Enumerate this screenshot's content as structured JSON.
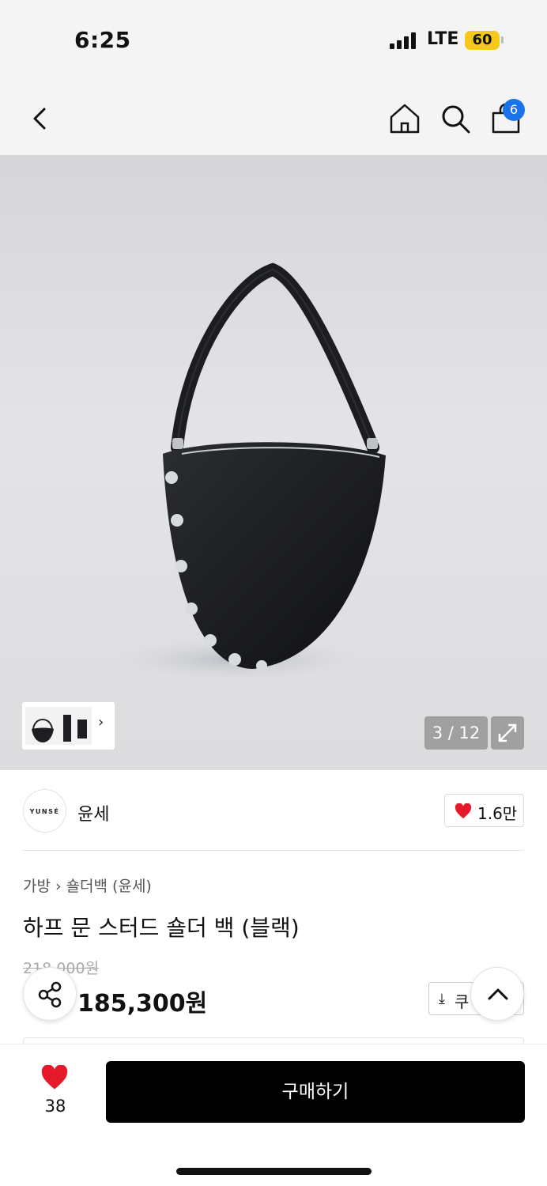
{
  "status": {
    "time": "6:25",
    "network": "LTE",
    "battery": "60"
  },
  "nav": {
    "back_icon": "chevron-left-icon",
    "home_icon": "home-icon",
    "search_icon": "search-icon",
    "cart_icon": "shopping-bag-icon",
    "cart_count": "6",
    "badge_color": "#1a73e8"
  },
  "gallery": {
    "counter": "3 / 12",
    "expand_icon": "expand-icon",
    "thumb_chevron": "›"
  },
  "brand": {
    "logo_text": "YUNSÉ",
    "name": "윤세",
    "likes": "1.6만"
  },
  "breadcrumb": {
    "category": "가방",
    "separator": "›",
    "subcategory": "숄더백 (윤세)"
  },
  "product": {
    "name": "하프 문 스터드 숄더 백 (블랙)",
    "original_price": "218,000원",
    "sale_price": "185,300원",
    "coupon_label": "쿠"
  },
  "bottom": {
    "wish_count": "38",
    "buy_label": "구매하기",
    "heart_color": "#e6192b"
  }
}
